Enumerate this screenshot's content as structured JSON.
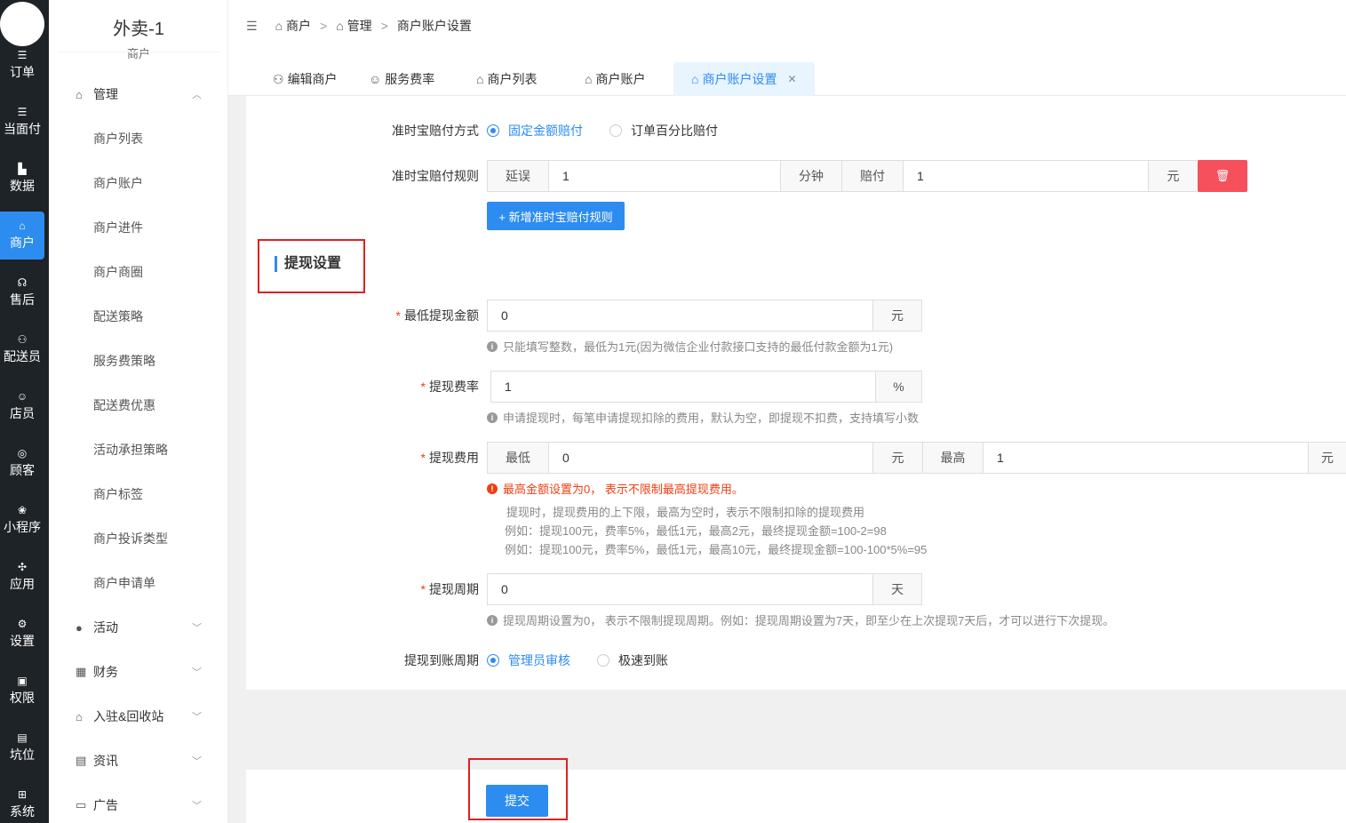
{
  "rail": {
    "items": [
      {
        "icon": "list-icon",
        "glyph": "☰",
        "label": "订单"
      },
      {
        "icon": "list-icon",
        "glyph": "☰",
        "label": "当面付"
      },
      {
        "icon": "bar-chart-icon",
        "glyph": "▙",
        "label": "数据"
      },
      {
        "icon": "store-icon",
        "glyph": "⌂",
        "label": "商户"
      },
      {
        "icon": "headset-icon",
        "glyph": "☊",
        "label": "售后"
      },
      {
        "icon": "scooter-icon",
        "glyph": "⚇",
        "label": "配送员"
      },
      {
        "icon": "users-icon",
        "glyph": "☺",
        "label": "店员"
      },
      {
        "icon": "customer-icon",
        "glyph": "◎",
        "label": "顾客"
      },
      {
        "icon": "wechat-icon",
        "glyph": "❀",
        "label": "小程序"
      },
      {
        "icon": "apps-icon",
        "glyph": "✣",
        "label": "应用"
      },
      {
        "icon": "settings-icon",
        "glyph": "⚙",
        "label": "设置"
      },
      {
        "icon": "lock-icon",
        "glyph": "▣",
        "label": "权限"
      },
      {
        "icon": "position-icon",
        "glyph": "▤",
        "label": "坑位"
      },
      {
        "icon": "windows-icon",
        "glyph": "⊞",
        "label": "系统"
      }
    ]
  },
  "side": {
    "title": "外卖-1",
    "subtitle": "商户",
    "group_manage": "管理",
    "sub_items": [
      "商户列表",
      "商户账户",
      "商户进件",
      "商户商圈",
      "配送策略",
      "服务费策略",
      "配送费优惠",
      "活动承担策略",
      "商户标签",
      "商户投诉类型",
      "商户申请单"
    ],
    "groups": [
      {
        "icon": "user-circle-icon",
        "glyph": "●",
        "label": "活动"
      },
      {
        "icon": "finance-icon",
        "glyph": "▦",
        "label": "财务"
      },
      {
        "icon": "store-icon",
        "glyph": "⌂",
        "label": "入驻&回收站"
      },
      {
        "icon": "news-icon",
        "glyph": "▤",
        "label": "资讯"
      },
      {
        "icon": "monitor-icon",
        "glyph": "▭",
        "label": "广告"
      }
    ]
  },
  "header": {
    "crumbs": [
      "商户",
      "管理",
      "商户账户设置"
    ]
  },
  "tabs": [
    {
      "icon": "scooter-icon",
      "glyph": "⚇",
      "label": "编辑商户"
    },
    {
      "icon": "users-icon",
      "glyph": "☺",
      "label": "服务费率"
    },
    {
      "icon": "store-icon",
      "glyph": "⌂",
      "label": "商户列表"
    },
    {
      "icon": "store-icon",
      "glyph": "⌂",
      "label": "商户账户"
    },
    {
      "icon": "store-icon",
      "glyph": "⌂",
      "label": "商户账户设置"
    }
  ],
  "form": {
    "pay_method_label": "准时宝赔付方式",
    "pay_method_options": [
      "固定金额赔付",
      "订单百分比赔付"
    ],
    "pay_rule_label": "准时宝赔付规则",
    "delay_label": "延误",
    "delay_value": "1",
    "minute_unit": "分钟",
    "compensate_label": "赔付",
    "compensate_value": "1",
    "yuan_unit": "元",
    "add_rule_button": "+ 新增准时宝赔付规则",
    "section_title": "提现设置",
    "min_withdraw_label": "最低提现金额",
    "min_withdraw_value": "0",
    "min_withdraw_unit": "元",
    "min_withdraw_hint": "只能填写整数，最低为1元(因为微信企业付款接口支持的最低付款金额为1元)",
    "rate_label": "提现费率",
    "rate_value": "1",
    "rate_unit": "%",
    "rate_hint": "申请提现时，每笔申请提现扣除的费用，默认为空，即提现不扣费，支持填写小数",
    "fee_label": "提现费用",
    "fee_min_label": "最低",
    "fee_min_value": "0",
    "fee_min_unit": "元",
    "fee_max_label": "最高",
    "fee_max_value": "1",
    "fee_max_unit": "元",
    "fee_error": "最高金额设置为0， 表示不限制最高提现费用。",
    "fee_note_1": "提现时，提现费用的上下限，最高为空时，表示不限制扣除的提现费用",
    "fee_note_2": "例如：提现100元，费率5%，最低1元，最高2元，最终提现金额=100-2=98",
    "fee_note_3": "例如：提现100元，费率5%，最低1元，最高10元，最终提现金额=100-100*5%=95",
    "period_label": "提现周期",
    "period_value": "0",
    "period_unit": "天",
    "period_hint": "提现周期设置为0， 表示不限制提现周期。例如：提现周期设置为7天，即至少在上次提现7天后，才可以进行下次提现。",
    "arrival_label": "提现到账周期",
    "arrival_options": [
      "管理员审核",
      "极速到账"
    ],
    "submit_button": "提交"
  },
  "colors": {
    "primary": "#2d8cf0",
    "danger": "#f5505b",
    "rail_bg": "#1e2327",
    "highlight_box": "#e02020"
  }
}
